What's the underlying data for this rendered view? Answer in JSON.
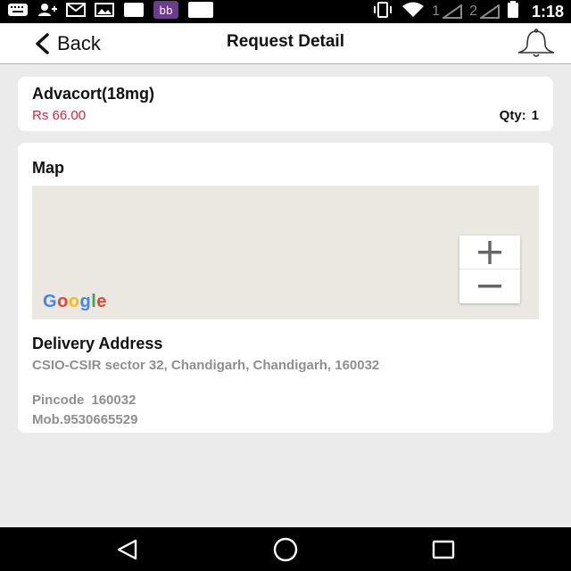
{
  "status_bar": {
    "sim1": "1",
    "sim2": "2",
    "time": "1:18",
    "icons": [
      "keyboard-icon",
      "person-add-icon",
      "gmail-icon",
      "image-icon",
      "square-icon",
      "bb-icon",
      "square-icon",
      "vibrate-icon",
      "wifi-icon",
      "signal-icon",
      "battery-icon"
    ]
  },
  "header": {
    "back_label": "Back",
    "title": "Request Detail",
    "accent_color": "#e2a3a6"
  },
  "product": {
    "name": "Advacort(18mg)",
    "price": "Rs 66.00",
    "qty_label": "Qty:",
    "qty_value": "1",
    "price_color": "#d6283f"
  },
  "map": {
    "title": "Map",
    "zoom_in": "+",
    "zoom_out": "−",
    "logo_letters": [
      "G",
      "o",
      "o",
      "g",
      "l",
      "e"
    ],
    "logo_colors": [
      "#4285F4",
      "#EA4335",
      "#FBBC05",
      "#4285F4",
      "#34A853",
      "#EA4335"
    ]
  },
  "delivery": {
    "title": "Delivery Address",
    "address": "CSIO-CSIR sector 32, Chandigarh, Chandigarh, 160032",
    "pincode_label": "Pincode",
    "pincode_value": "160032",
    "mobile": "Mob.9530665529"
  },
  "nav": {
    "icons": [
      "back-triangle-icon",
      "home-circle-icon",
      "recents-square-icon"
    ]
  }
}
